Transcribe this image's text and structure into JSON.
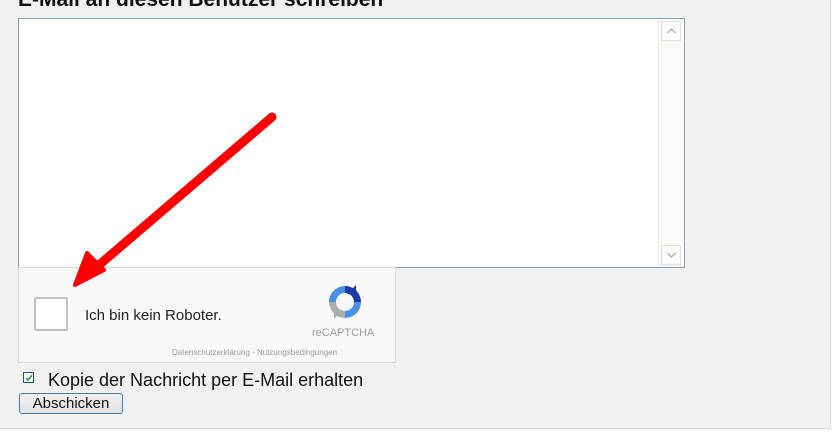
{
  "heading": "E-Mail an diesen Benutzer schreiben",
  "message": {
    "value": ""
  },
  "recaptcha": {
    "label": "Ich bin kein Roboter.",
    "brand": "reCAPTCHA",
    "privacy_link": "Datenschutzerklärung",
    "separator": "-",
    "terms_link": "Nutzungsbedingungen",
    "checked": false
  },
  "copy_option": {
    "label": "Kopie der Nachricht per E-Mail erhalten",
    "checked": true
  },
  "submit_label": "Abschicken",
  "colors": {
    "panel_bg": "#f1f1f1",
    "annotation_arrow": "#ff0000",
    "recaptcha_blue": "#4a90e2",
    "recaptcha_gray": "#adadad"
  }
}
